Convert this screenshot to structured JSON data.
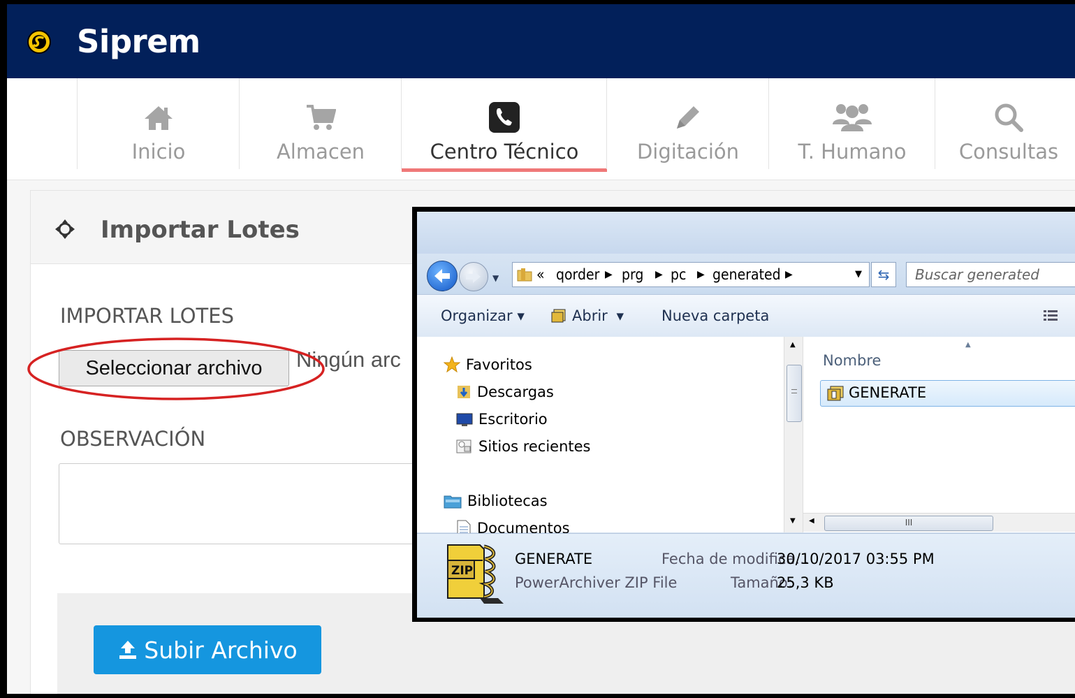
{
  "app": {
    "brand": "Siprem",
    "colors": {
      "header_bg": "#02205a",
      "accent_underline": "#ef7878",
      "upload_button": "#1596df",
      "highlight_ellipse": "#d22"
    }
  },
  "nav": {
    "items": [
      {
        "label": "Inicio",
        "icon": "home-icon"
      },
      {
        "label": "Almacen",
        "icon": "cart-icon"
      },
      {
        "label": "Centro Técnico",
        "icon": "phone-icon",
        "active": true
      },
      {
        "label": "Digitación",
        "icon": "pencil-icon"
      },
      {
        "label": "T. Humano",
        "icon": "users-icon"
      },
      {
        "label": "Consultas",
        "icon": "search-icon"
      }
    ]
  },
  "panel": {
    "title": "Importar Lotes",
    "import_label": "IMPORTAR LOTES",
    "select_button": "Seleccionar archivo",
    "no_file_text": "Ningún arc",
    "obs_label": "OBSERVACIÓN",
    "upload_button": "Subir Archivo"
  },
  "dialog": {
    "breadcrumb": {
      "prefix": "«",
      "parts": [
        "qorder",
        "prg",
        "pc",
        "generated"
      ]
    },
    "search_placeholder": "Buscar generated",
    "commands": {
      "organize": "Organizar",
      "open": "Abrir",
      "new_folder": "Nueva carpeta"
    },
    "tree": {
      "favorites": "Favoritos",
      "downloads": "Descargas",
      "desktop": "Escritorio",
      "recent": "Sitios recientes",
      "libraries": "Bibliotecas",
      "documents": "Documentos"
    },
    "column_name": "Nombre",
    "file_name": "GENERATE",
    "details": {
      "name": "GENERATE",
      "type": "PowerArchiver ZIP File",
      "modified_label": "Fecha de modifica...",
      "modified_value": "30/10/2017 03:55 PM",
      "size_label": "Tamaño:",
      "size_value": "25,3 KB",
      "zip_glyph": "ZIP"
    }
  }
}
